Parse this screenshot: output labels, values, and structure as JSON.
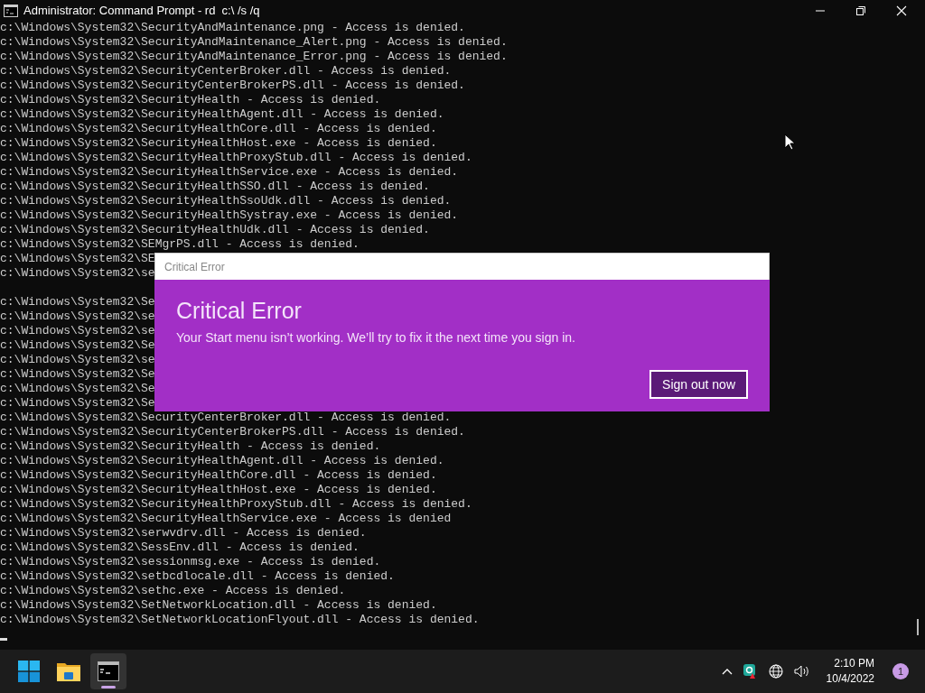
{
  "window": {
    "title": "Administrator: Command Prompt - rd  c:\\ /s /q"
  },
  "console": {
    "lines": [
      {
        "kind": "output",
        "text": "c:\\Windows\\System32\\SecurityAndMaintenance.png - Access is denied."
      },
      {
        "kind": "output",
        "text": "c:\\Windows\\System32\\SecurityAndMaintenance_Alert.png - Access is denied."
      },
      {
        "kind": "output",
        "text": "c:\\Windows\\System32\\SecurityAndMaintenance_Error.png - Access is denied."
      },
      {
        "kind": "output",
        "text": "c:\\Windows\\System32\\SecurityCenterBroker.dll - Access is denied."
      },
      {
        "kind": "output",
        "text": "c:\\Windows\\System32\\SecurityCenterBrokerPS.dll - Access is denied."
      },
      {
        "kind": "output",
        "text": "c:\\Windows\\System32\\SecurityHealth - Access is denied."
      },
      {
        "kind": "output",
        "text": "c:\\Windows\\System32\\SecurityHealthAgent.dll - Access is denied."
      },
      {
        "kind": "output",
        "text": "c:\\Windows\\System32\\SecurityHealthCore.dll - Access is denied."
      },
      {
        "kind": "output",
        "text": "c:\\Windows\\System32\\SecurityHealthHost.exe - Access is denied."
      },
      {
        "kind": "output",
        "text": "c:\\Windows\\System32\\SecurityHealthProxyStub.dll - Access is denied."
      },
      {
        "kind": "output",
        "text": "c:\\Windows\\System32\\SecurityHealthService.exe - Access is denied."
      },
      {
        "kind": "output",
        "text": "c:\\Windows\\System32\\SecurityHealthSSO.dll - Access is denied."
      },
      {
        "kind": "output",
        "text": "c:\\Windows\\System32\\SecurityHealthSsoUdk.dll - Access is denied."
      },
      {
        "kind": "output",
        "text": "c:\\Windows\\System32\\SecurityHealthSystray.exe - Access is denied."
      },
      {
        "kind": "output",
        "text": "c:\\Windows\\System32\\SecurityHealthUdk.dll - Access is denied."
      },
      {
        "kind": "output",
        "text": "c:\\Windows\\System32\\SEMgrPS.dll - Access is denied."
      },
      {
        "kind": "output",
        "text": "c:\\Windows\\System32\\SE"
      },
      {
        "kind": "output",
        "text": "c:\\Windows\\System32\\se"
      },
      {
        "kind": "blank"
      },
      {
        "kind": "output",
        "text": "c:\\Windows\\System32\\Se"
      },
      {
        "kind": "output",
        "text": "c:\\Windows\\System32\\se"
      },
      {
        "kind": "output",
        "text": "c:\\Windows\\System32\\se"
      },
      {
        "kind": "output",
        "text": "c:\\Windows\\System32\\Se"
      },
      {
        "kind": "output",
        "text": "c:\\Windows\\System32\\se"
      },
      {
        "kind": "output",
        "text": "c:\\Windows\\System32\\Se"
      },
      {
        "kind": "output",
        "text": "c:\\Windows\\System32\\Se"
      },
      {
        "kind": "output",
        "text": "c:\\Windows\\System32\\Se"
      },
      {
        "kind": "output",
        "text": "c:\\Windows\\System32\\SecurityCenterBroker.dll - Access is denied."
      },
      {
        "kind": "output",
        "text": "c:\\Windows\\System32\\SecurityCenterBrokerPS.dll - Access is denied."
      },
      {
        "kind": "output",
        "text": "c:\\Windows\\System32\\SecurityHealth - Access is denied."
      },
      {
        "kind": "output",
        "text": "c:\\Windows\\System32\\SecurityHealthAgent.dll - Access is denied."
      },
      {
        "kind": "output",
        "text": "c:\\Windows\\System32\\SecurityHealthCore.dll - Access is denied."
      },
      {
        "kind": "output",
        "text": "c:\\Windows\\System32\\SecurityHealthHost.exe - Access is denied."
      },
      {
        "kind": "output",
        "text": "c:\\Windows\\System32\\SecurityHealthProxyStub.dll - Access is denied."
      },
      {
        "kind": "output",
        "text": "c:\\Windows\\System32\\SecurityHealthService.exe - Access is denied"
      },
      {
        "kind": "output",
        "text": "c:\\Windows\\System32\\serwvdrv.dll - Access is denied."
      },
      {
        "kind": "output",
        "text": "c:\\Windows\\System32\\SessEnv.dll - Access is denied."
      },
      {
        "kind": "output",
        "text": "c:\\Windows\\System32\\sessionmsg.exe - Access is denied."
      },
      {
        "kind": "output",
        "text": "c:\\Windows\\System32\\setbcdlocale.dll - Access is denied."
      },
      {
        "kind": "output",
        "text": "c:\\Windows\\System32\\sethc.exe - Access is denied."
      },
      {
        "kind": "output",
        "text": "c:\\Windows\\System32\\SetNetworkLocation.dll - Access is denied."
      },
      {
        "kind": "output",
        "text": "c:\\Windows\\System32\\SetNetworkLocationFlyout.dll - Access is denied."
      },
      {
        "kind": "cursor"
      }
    ]
  },
  "dialog": {
    "title": "Critical Error",
    "heading": "Critical Error",
    "message": "Your Start menu isn’t working. We’ll try to fix it the next time you sign in.",
    "button": "Sign out now"
  },
  "taskbar": {
    "apps": [
      {
        "kind": "start",
        "selected": false
      },
      {
        "kind": "explorer",
        "selected": false
      },
      {
        "kind": "terminal",
        "selected": true
      }
    ],
    "time": "2:10 PM",
    "date": "10/4/2022",
    "notification_count": "1"
  }
}
